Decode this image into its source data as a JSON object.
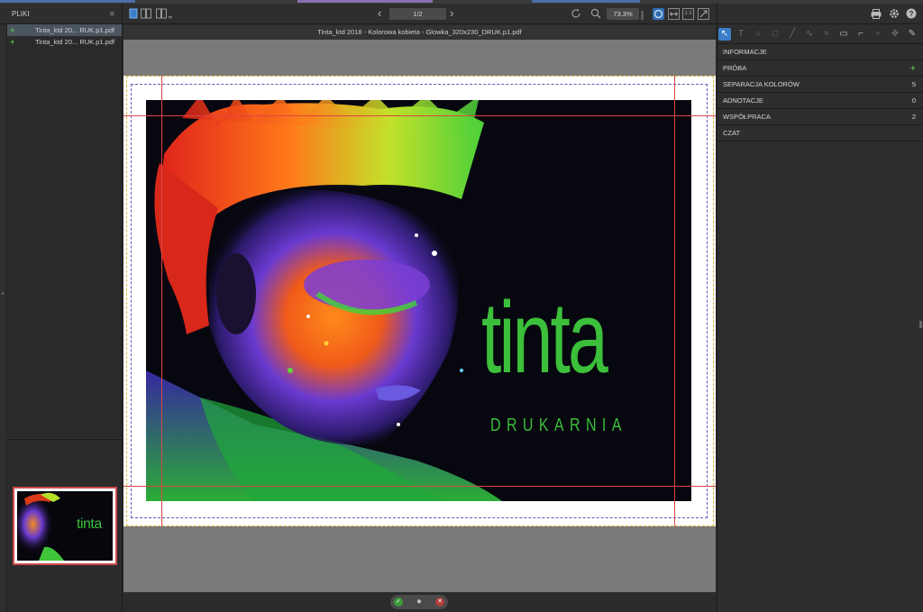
{
  "left_panel": {
    "title": "PLIKI",
    "menu_glyph": "≡",
    "files": [
      {
        "name": "Tinta_ktd 20... RUK.p1.pdf",
        "selected": true
      },
      {
        "name": "Tinta_ktd 20... RUK.p1.pdf",
        "selected": false
      }
    ],
    "thumb_word": "tinta"
  },
  "toolbar": {
    "page_indicator": "1/2",
    "zoom": "73.3%",
    "prev_glyph": "‹",
    "next_glyph": "›",
    "fit_one": "1:1"
  },
  "document": {
    "title": "Tinta_ktd 2018 - Kolorowa kobieta - Glowka_320x230_DRUK.p1.pdf",
    "brand_word": "tinta",
    "brand_sub": "DRUKARNIA"
  },
  "right_panel": {
    "sections": [
      {
        "label": "INFORMACJE",
        "value": ""
      },
      {
        "label": "PRÓBA",
        "value": "✈"
      },
      {
        "label": "SEPARACJA KOLORÓW",
        "value": "5"
      },
      {
        "label": "ADNOTACJE",
        "value": "0"
      },
      {
        "label": "WSPÓŁPRACA",
        "value": "2"
      },
      {
        "label": "CZAT",
        "value": ""
      }
    ]
  },
  "colors": {
    "accent_blue": "#3b7ec8",
    "brand_green": "#3cbf3a",
    "guide_red": "#dd4444",
    "bleed_yellow": "#d7b83a",
    "trim_blue": "#5a5ab8"
  }
}
